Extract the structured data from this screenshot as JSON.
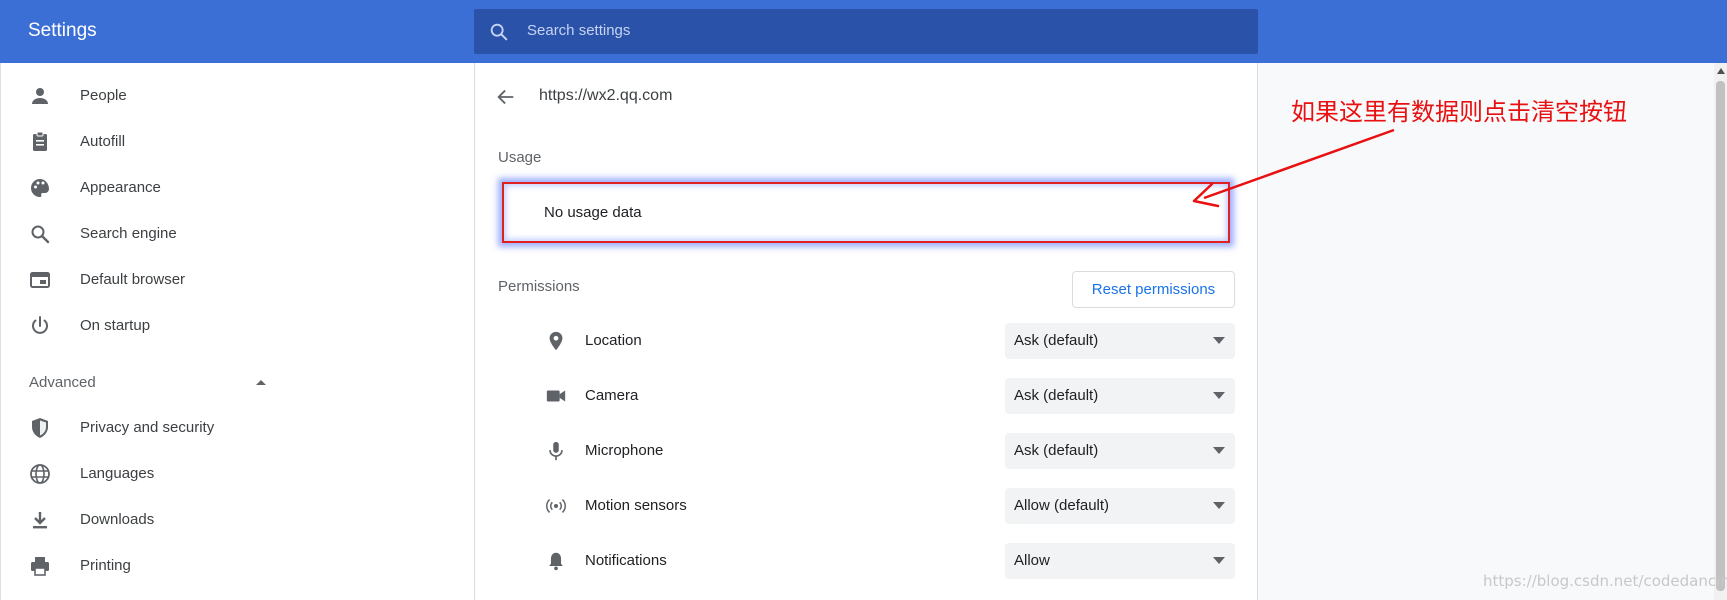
{
  "header": {
    "title": "Settings",
    "search_placeholder": "Search settings"
  },
  "sidebar": {
    "items": [
      {
        "label": "People",
        "icon": "person-icon"
      },
      {
        "label": "Autofill",
        "icon": "clipboard-icon"
      },
      {
        "label": "Appearance",
        "icon": "palette-icon"
      },
      {
        "label": "Search engine",
        "icon": "search-icon"
      },
      {
        "label": "Default browser",
        "icon": "browser-window-icon"
      },
      {
        "label": "On startup",
        "icon": "power-icon"
      }
    ],
    "advanced_label": "Advanced",
    "advanced_items": [
      {
        "label": "Privacy and security",
        "icon": "shield-icon"
      },
      {
        "label": "Languages",
        "icon": "globe-icon"
      },
      {
        "label": "Downloads",
        "icon": "download-icon"
      },
      {
        "label": "Printing",
        "icon": "printer-icon"
      }
    ]
  },
  "site": {
    "url": "https://wx2.qq.com",
    "usage_label": "Usage",
    "usage_text": "No usage data",
    "permissions_label": "Permissions",
    "reset_label": "Reset permissions",
    "permissions": [
      {
        "label": "Location",
        "value": "Ask (default)",
        "icon": "location-pin-icon"
      },
      {
        "label": "Camera",
        "value": "Ask (default)",
        "icon": "camera-icon"
      },
      {
        "label": "Microphone",
        "value": "Ask (default)",
        "icon": "microphone-icon"
      },
      {
        "label": "Motion sensors",
        "value": "Allow (default)",
        "icon": "motion-sensor-icon"
      },
      {
        "label": "Notifications",
        "value": "Allow",
        "icon": "bell-icon"
      }
    ]
  },
  "annotation": {
    "text": "如果这里有数据则点击清空按钮"
  },
  "watermark": "https://blog.csdn.net/codedancing",
  "colors": {
    "header": "#3c6fd6",
    "search_box": "#2a52a8",
    "accent_link": "#1a73e8",
    "annotation_red": "#e81010"
  }
}
